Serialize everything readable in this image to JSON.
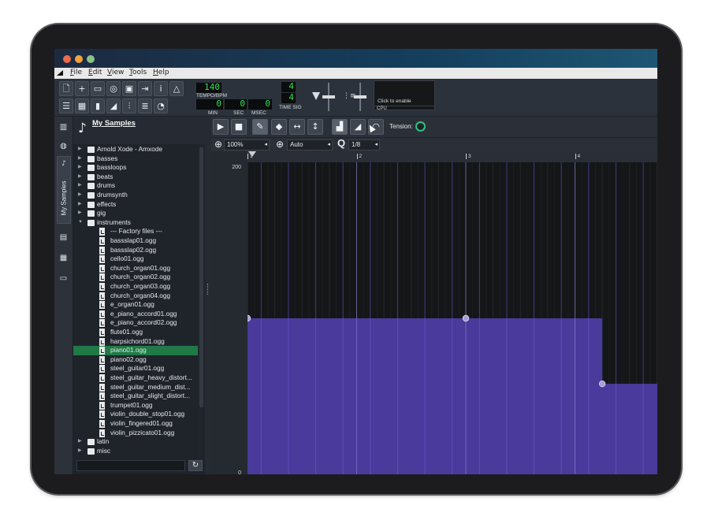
{
  "menubar": [
    "File",
    "Edit",
    "View",
    "Tools",
    "Help"
  ],
  "transport": {
    "tempo": "140",
    "tempo_label": "TEMPO/BPM",
    "min": "0",
    "min_label": "MIN",
    "sec": "0",
    "sec_label": "SEC",
    "msec": "0",
    "msec_label": "MSEC",
    "timesig_num": "4",
    "timesig_den": "4",
    "timesig_label": "TIME SIG"
  },
  "cpu": {
    "click_label": "Click to enable",
    "label": "CPU"
  },
  "sidebar": {
    "tab_label": "My Samples"
  },
  "browser": {
    "title": "My Samples",
    "tree": [
      {
        "name": "Arnold Xode - Amxode",
        "type": "folder",
        "depth": 0
      },
      {
        "name": "basses",
        "type": "folder",
        "depth": 0
      },
      {
        "name": "bassloops",
        "type": "folder",
        "depth": 0
      },
      {
        "name": "beats",
        "type": "folder",
        "depth": 0
      },
      {
        "name": "drums",
        "type": "folder",
        "depth": 0
      },
      {
        "name": "drumsynth",
        "type": "folder",
        "depth": 0
      },
      {
        "name": "effects",
        "type": "folder",
        "depth": 0
      },
      {
        "name": "gig",
        "type": "folder",
        "depth": 0
      },
      {
        "name": "instruments",
        "type": "folder-open",
        "depth": 0
      },
      {
        "name": "--- Factory files ---",
        "type": "info",
        "depth": 1
      },
      {
        "name": "bassslap01.ogg",
        "type": "file",
        "depth": 1
      },
      {
        "name": "bassslap02.ogg",
        "type": "file",
        "depth": 1
      },
      {
        "name": "cello01.ogg",
        "type": "file",
        "depth": 1
      },
      {
        "name": "church_organ01.ogg",
        "type": "file",
        "depth": 1
      },
      {
        "name": "church_organ02.ogg",
        "type": "file",
        "depth": 1
      },
      {
        "name": "church_organ03.ogg",
        "type": "file",
        "depth": 1
      },
      {
        "name": "church_organ04.ogg",
        "type": "file",
        "depth": 1
      },
      {
        "name": "e_organ01.ogg",
        "type": "file",
        "depth": 1
      },
      {
        "name": "e_piano_accord01.ogg",
        "type": "file",
        "depth": 1
      },
      {
        "name": "e_piano_accord02.ogg",
        "type": "file",
        "depth": 1
      },
      {
        "name": "flute01.ogg",
        "type": "file",
        "depth": 1
      },
      {
        "name": "harpsichord01.ogg",
        "type": "file",
        "depth": 1
      },
      {
        "name": "piano01.ogg",
        "type": "file",
        "depth": 1,
        "selected": true
      },
      {
        "name": "piano02.ogg",
        "type": "file",
        "depth": 1
      },
      {
        "name": "steel_guitar01.ogg",
        "type": "file",
        "depth": 1
      },
      {
        "name": "steel_guitar_heavy_distort...",
        "type": "file",
        "depth": 1
      },
      {
        "name": "steel_guitar_medium_dist...",
        "type": "file",
        "depth": 1
      },
      {
        "name": "steel_guitar_slight_distort...",
        "type": "file",
        "depth": 1
      },
      {
        "name": "trumpet01.ogg",
        "type": "file",
        "depth": 1
      },
      {
        "name": "violin_double_stop01.ogg",
        "type": "file",
        "depth": 1
      },
      {
        "name": "violin_fingered01.ogg",
        "type": "file",
        "depth": 1
      },
      {
        "name": "violin_pizzicato01.ogg",
        "type": "file",
        "depth": 1
      },
      {
        "name": "latin",
        "type": "folder",
        "depth": 0
      },
      {
        "name": "misc",
        "type": "folder",
        "depth": 0
      }
    ]
  },
  "editor": {
    "tension_label": "Tension:",
    "zoom_x": "100%",
    "zoom_y": "Auto",
    "quantize": "1/8",
    "bars": [
      "1",
      "2",
      "3",
      "4"
    ],
    "y_max": "200",
    "y_min": "0",
    "automation_points": [
      {
        "bar": 1.0,
        "value": 100
      },
      {
        "bar": 3.0,
        "value": 100
      },
      {
        "bar": 4.25,
        "value": 58
      }
    ],
    "colors": {
      "fill": "#4a3a9b",
      "line": "#6b5cd6",
      "point": "#a59fd6"
    }
  }
}
